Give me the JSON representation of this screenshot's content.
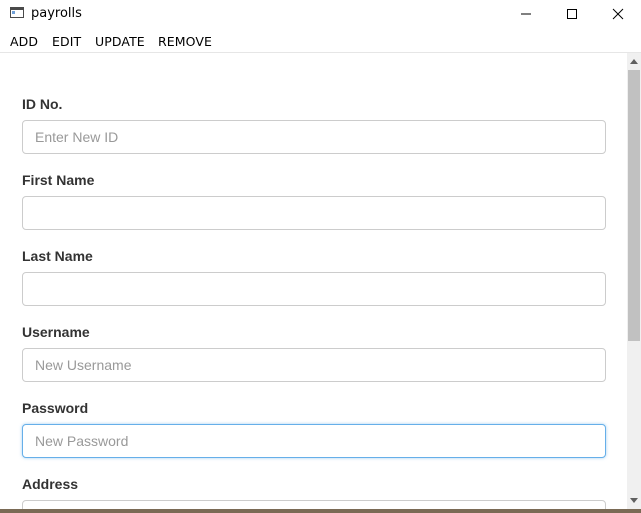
{
  "window": {
    "title": "payrolls"
  },
  "menu": {
    "add": "ADD",
    "edit": "EDIT",
    "update": "UPDATE",
    "remove": "REMOVE"
  },
  "form": {
    "fields": [
      {
        "label": "ID No.",
        "value": "",
        "placeholder": "Enter New ID"
      },
      {
        "label": "First Name",
        "value": "",
        "placeholder": ""
      },
      {
        "label": "Last Name",
        "value": "",
        "placeholder": ""
      },
      {
        "label": "Username",
        "value": "",
        "placeholder": "New Username"
      },
      {
        "label": "Password",
        "value": "",
        "placeholder": "New Password",
        "focused": true
      },
      {
        "label": "Address",
        "value": "",
        "placeholder": ""
      }
    ]
  },
  "icons": {
    "app": "window-app-icon",
    "minimize": "minimize-icon",
    "maximize": "maximize-icon",
    "close": "close-icon",
    "scroll_up": "scroll-up-arrow-icon",
    "scroll_down": "scroll-down-arrow-icon"
  },
  "colors": {
    "focus_border": "#66afe9",
    "input_border": "#cccccc",
    "label": "#333333",
    "placeholder": "#999999"
  }
}
